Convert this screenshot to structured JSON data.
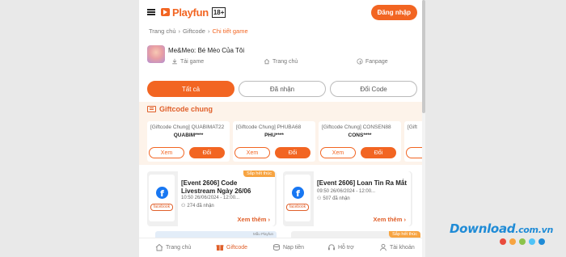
{
  "header": {
    "logo": "Playfun",
    "age_label": "18+",
    "login_label": "Đăng nhập"
  },
  "breadcrumb": [
    "Trang chủ",
    "Giftcode",
    "Chi tiết game"
  ],
  "game": {
    "name": "Me&Meo: Bé Mèo Của Tôi",
    "links": {
      "download": "Tải game",
      "home": "Trang chủ",
      "fanpage": "Fanpage"
    }
  },
  "tabs": [
    "Tất cả",
    "Đã nhận",
    "Đổi Code"
  ],
  "section": {
    "title": "Giftcode chung",
    "cards": [
      {
        "title": "[Giftcode Chung] QUABIMAT22",
        "code": "QUABIM****"
      },
      {
        "title": "[Giftcode Chung] PHUBA68",
        "code": "PHU****"
      },
      {
        "title": "[Giftcode Chung] CONSEN88",
        "code": "CONS****"
      },
      {
        "title": "[Gift",
        "code": ""
      }
    ],
    "xem_label": "Xem",
    "doi_label": "Đổi"
  },
  "events": [
    {
      "badge": "Sắp hết thúc",
      "fb_tag": "facebook",
      "title": "[Event 2606] Code Livestream Ngày 26/06",
      "date": "10:50 26/06/2024 - 12:00...",
      "count": "274 đã nhận",
      "more": "Xem thêm"
    },
    {
      "badge": "",
      "fb_tag": "facebook",
      "title": "[Event 2606] Loan Tin Ra Mắt",
      "date": "09:50 26/06/2024 - 12:00...",
      "count": "507 đã nhận",
      "more": "Xem thêm"
    }
  ],
  "peek": {
    "mau": "Mẫu Playfun",
    "badge": "Sắp hết thúc"
  },
  "nav": [
    "Trang chủ",
    "Giftcode",
    "Nạp tiền",
    "Hỗ trợ",
    "Tài khoản"
  ],
  "watermark": {
    "text": "Download",
    "suffix": ".com.vn",
    "dots": [
      "#e94b3c",
      "#f7a441",
      "#8bc34a",
      "#4fc3f7",
      "#1f8bd6"
    ]
  }
}
